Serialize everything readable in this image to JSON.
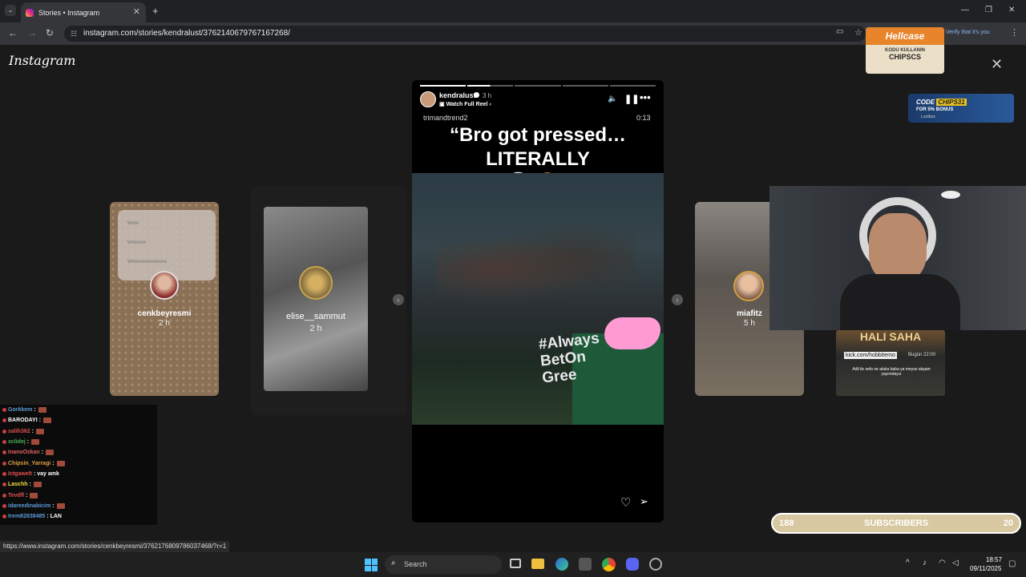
{
  "browser": {
    "tab_title": "Stories • Instagram",
    "new_tab": "+",
    "url": "instagram.com/stories/kendralust/3762140679767167268/",
    "status_url": "https://www.instagram.com/stories/cenkbeyresmi/3762176809786037468/?r=1"
  },
  "instagram": {
    "logo": "Instagram",
    "main_story": {
      "username": "kendralust",
      "time": "3 h",
      "watch_full_reel": "Watch Full Reel",
      "audio_name": "trimandtrend2",
      "duration": "0:13",
      "caption_line1": "“Bro got pressed… LITERALLY",
      "caption_line2": "💀 😂”",
      "video_shirt_text": "#Always BetOn Gree"
    },
    "side_stories": [
      {
        "name": "cenkbeyresmi",
        "time": "2 h",
        "quiz_lines": [
          "Www",
          "Wwwww",
          "Wwwwwwwwwww"
        ]
      },
      {
        "name": "elise__sammut",
        "time": "2 h"
      },
      {
        "name": "miafitz",
        "time": "5 h"
      }
    ]
  },
  "overlays": {
    "hellcase_brand": "Hellcase",
    "hellcase_code_label": "KODU KULLANIN",
    "hellcase_code": "CHIPSCS",
    "verify_text": "Verify that it's you",
    "lootbox_code_label": "CODE",
    "lootbox_code": "CHIPS31",
    "lootbox_bonus": "FOR 5% BONUS",
    "lootbox_brand": "Lootbox",
    "kick_url": "kick.com/hobbitemo",
    "kick_time": "Bugün 22:00",
    "kick_sign": "HALI SAHA",
    "kick_sub": "Adli ile sefo ne alaka baba ya meyse akşam yayımdayız",
    "subscribers_left": "188",
    "subscribers_label": "SUBSCRIBERS",
    "subscribers_right": "20"
  },
  "chat": [
    {
      "user": "Gorkkem",
      "color": "#5b9bd5",
      "msg": ""
    },
    {
      "user": "BARODAYI",
      "color": "#ffffff",
      "msg": ""
    },
    {
      "user": "salih362",
      "color": "#e05050",
      "msg": ""
    },
    {
      "user": "xclidej",
      "color": "#4caf50",
      "msg": ""
    },
    {
      "user": "InanoOzkan",
      "color": "#e06060",
      "msg": ""
    },
    {
      "user": "Chipsin_Yarragi",
      "color": "#e0a040",
      "msg": ""
    },
    {
      "user": "Ictgawelt",
      "color": "#e05050",
      "msg": ": vay amk"
    },
    {
      "user": "Laschh",
      "color": "#f0e040",
      "msg": ""
    },
    {
      "user": "Tevdfl",
      "color": "#e05050",
      "msg": ""
    },
    {
      "user": "idareedinabicim",
      "color": "#5b9bd5",
      "msg": ""
    },
    {
      "user": "trem82838485",
      "color": "#5b9bd5",
      "msg": ": LAN"
    }
  ],
  "taskbar": {
    "search_placeholder": "Search",
    "time": "18:57",
    "date": "09/11/2025"
  }
}
